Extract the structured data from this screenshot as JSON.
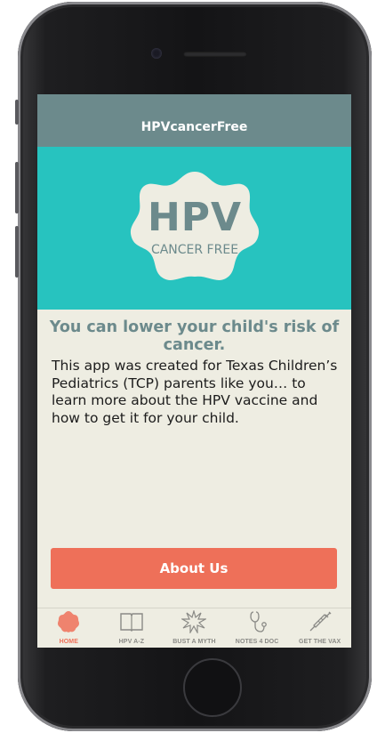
{
  "app": {
    "nav_title": "HPVcancerFree"
  },
  "hero": {
    "logo_main": "HPV",
    "logo_sub": "CANCER FREE"
  },
  "main": {
    "headline": "You can lower your child's risk of cancer.",
    "body": "This app was created for Texas Children’s Pediatrics (TCP) parents like you… to learn more about the HPV vaccine and how to get it for your child.",
    "about_button": "About Us"
  },
  "tabs": [
    {
      "label": "HOME",
      "icon": "flower-icon",
      "active": true
    },
    {
      "label": "HPV A-Z",
      "icon": "book-icon",
      "active": false
    },
    {
      "label": "BUST A MYTH",
      "icon": "burst-icon",
      "active": false
    },
    {
      "label": "NOTES 4 DOC",
      "icon": "stethoscope-icon",
      "active": false
    },
    {
      "label": "GET THE VAX",
      "icon": "syringe-icon",
      "active": false
    }
  ],
  "colors": {
    "nav": "#6c8a8c",
    "hero": "#27c3bf",
    "accent": "#ee7059",
    "background": "#eeede2"
  }
}
